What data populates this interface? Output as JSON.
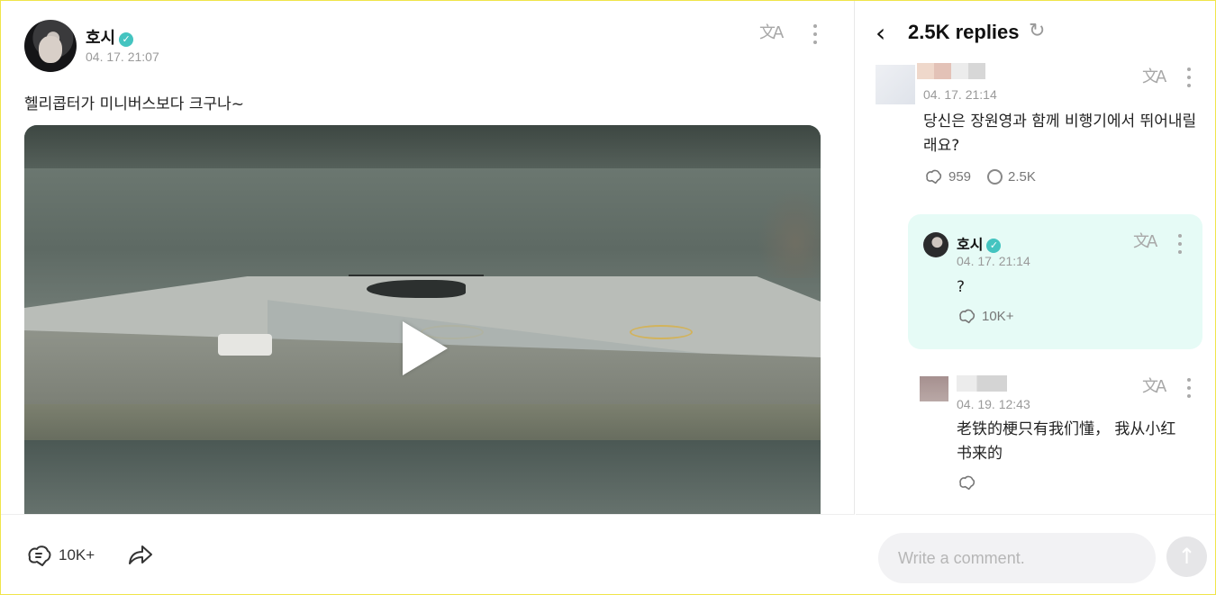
{
  "post": {
    "author": "호시",
    "date": "04. 17. 21:07",
    "text": "헬리콥터가 미니버스보다 크구나~",
    "like_count": "10K+"
  },
  "replies": {
    "title": "2.5K replies",
    "comments": [
      {
        "author": "",
        "date": "04. 17. 21:14",
        "text": "당신은 장원영과 함께 비행기에서 뛰어내릴래요?",
        "likes": "959",
        "reply_count": "2.5K"
      },
      {
        "author": "호시",
        "date": "04. 17. 21:14",
        "text": "?",
        "likes": "10K+"
      },
      {
        "author": "",
        "date": "04. 19. 12:43",
        "text": "老铁的梗只有我们懂， 我从小红书来的",
        "likes": ""
      }
    ],
    "composer_placeholder": "Write a comment."
  },
  "colors": {
    "highlight_bg": "#e6fbf6",
    "verified": "#44c4c0",
    "frame": "#f0e54a"
  },
  "icons": [
    "translate-icon",
    "more-icon",
    "verified-icon",
    "like-icon",
    "share-icon",
    "back-icon",
    "refresh-icon",
    "comment-icon",
    "send-icon",
    "play-icon"
  ]
}
